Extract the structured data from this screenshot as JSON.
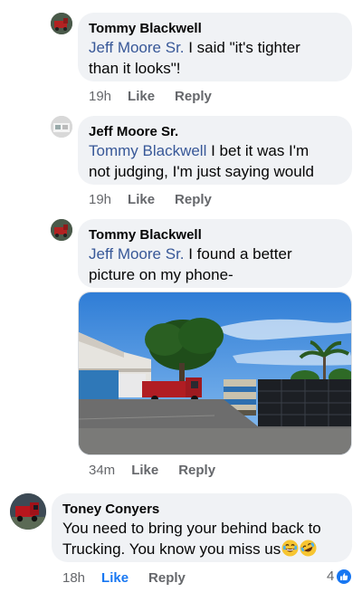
{
  "comments": [
    {
      "author": "Tommy Blackwell",
      "mention": "Jeff Moore Sr.",
      "text_line1": " I said \"it's tighter",
      "text_line2": "than it looks\"!",
      "time": "19h",
      "like_label": "Like",
      "reply_label": "Reply"
    },
    {
      "author": "Jeff Moore Sr.",
      "mention": "Tommy Blackwell",
      "text_line1": " I bet it was I'm",
      "text_line2": "not judging, I'm just saying would",
      "time": "19h",
      "like_label": "Like",
      "reply_label": "Reply"
    },
    {
      "author": "Tommy Blackwell",
      "mention": "Jeff Moore Sr.",
      "text_line1": " I found a better",
      "text_line2": "picture on my phone-",
      "time": "34m",
      "like_label": "Like",
      "reply_label": "Reply",
      "has_photo": true
    },
    {
      "author": "Toney Conyers",
      "text_line1": "You  need to bring your behind back to",
      "text_line2": "Trucking. You know you miss us",
      "emojis": [
        "laughing-face",
        "rolling-laughing-face"
      ],
      "time": "18h",
      "like_label": "Like",
      "reply_label": "Reply",
      "liked": true,
      "reaction_count": "4",
      "reaction_type": "like"
    }
  ],
  "colors": {
    "bubble": "#f0f2f5",
    "mention": "#385898",
    "meta": "#65676b",
    "like_blue": "#1877f2"
  }
}
